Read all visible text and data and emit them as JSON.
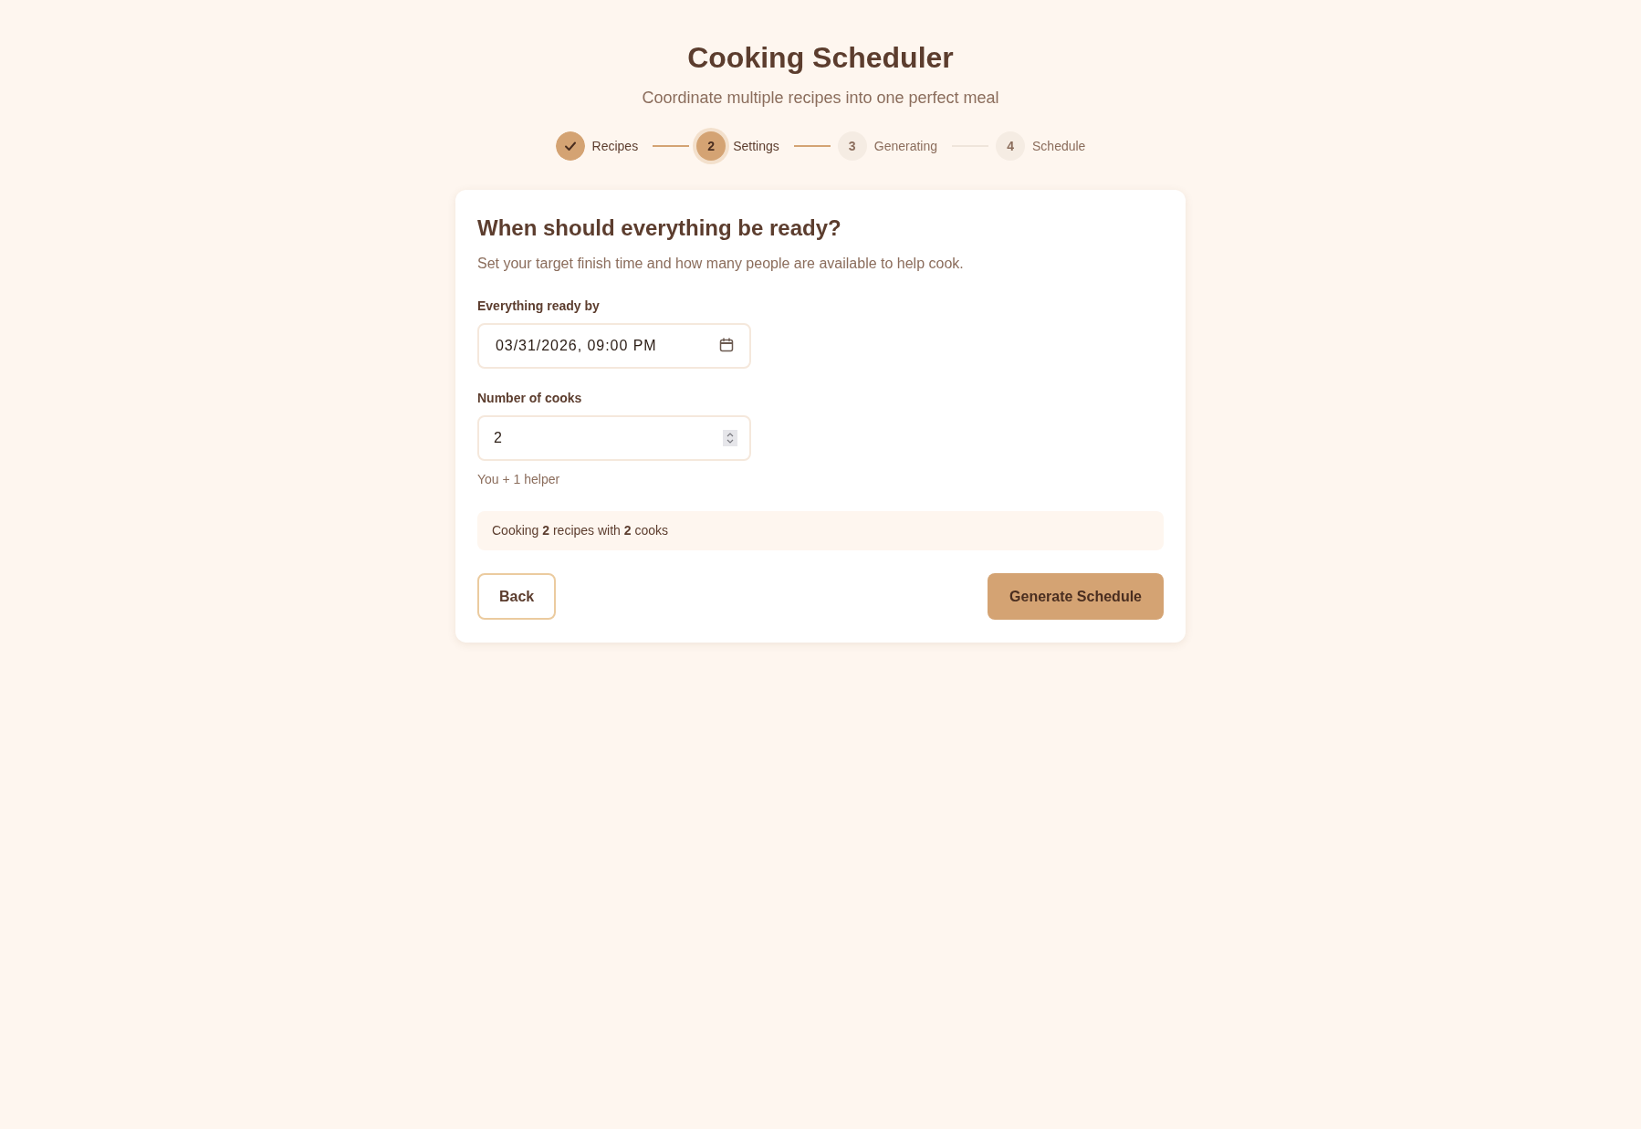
{
  "header": {
    "title": "Cooking Scheduler",
    "subtitle": "Coordinate multiple recipes into one perfect meal"
  },
  "steps": [
    {
      "label": "Recipes",
      "completed": true,
      "selected": false
    },
    {
      "label": "Settings",
      "number": "2",
      "completed": false,
      "selected": true
    },
    {
      "label": "Generating",
      "number": "3",
      "completed": false,
      "selected": false
    },
    {
      "label": "Schedule",
      "number": "4",
      "completed": false,
      "selected": false
    }
  ],
  "card": {
    "heading": "When should everything be ready?",
    "description": "Set your target finish time and how many people are available to help cook.",
    "fields": [
      {
        "kind": "datetime",
        "label": "Everything ready by",
        "value": "03/31/2026, 09:00 PM"
      },
      {
        "kind": "number",
        "label": "Number of cooks",
        "value": "2",
        "hint": "You + 1 helper"
      }
    ],
    "summary": "Cooking **2** recipes with **2** cooks",
    "buttons": [
      {
        "label": "Back",
        "kind": "secondary"
      },
      {
        "label": "Generate Schedule",
        "kind": "primary"
      }
    ]
  }
}
